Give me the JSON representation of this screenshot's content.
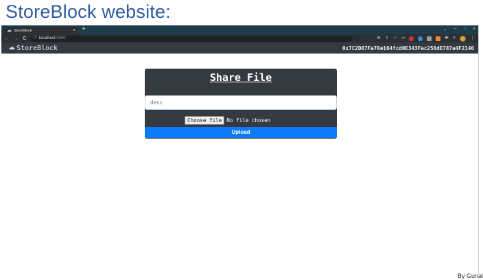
{
  "slide": {
    "title": "StoreBlock website:",
    "credit": "By Gunal"
  },
  "browser": {
    "tab": {
      "title": "StoreBlock",
      "favicon": "cloud-icon",
      "close": "×"
    },
    "new_tab": "+",
    "window_controls": [
      "⌄",
      "−",
      "▫",
      "×"
    ],
    "nav_icons": [
      "←",
      "→",
      "C"
    ],
    "url": {
      "host": "localhost",
      "port": ":3000"
    },
    "toolbar_icons": [
      "zoom-icon",
      "share-icon",
      "star-icon",
      "link-icon",
      "extension-red-icon",
      "extension-blue-icon",
      "extension-grey-icon",
      "extension-orange-icon",
      "puzzle-icon",
      "reading-list-icon",
      "profile-avatar",
      "menu-icon"
    ]
  },
  "app": {
    "brand": "StoreBlock",
    "account": "0x7C2D87Fa78e164fcd0E343Fac258dE787a4F2140"
  },
  "card": {
    "title": "Share File",
    "desc_placeholder": "desc",
    "choose_file_label": "Choose file",
    "file_status": "No file chosen",
    "upload_label": "Upload"
  },
  "colors": {
    "navbar": "#343a40",
    "upload_button": "#0d7bf7",
    "tabstrip": "#1f3d48",
    "slide_title": "#2e5b9e"
  }
}
